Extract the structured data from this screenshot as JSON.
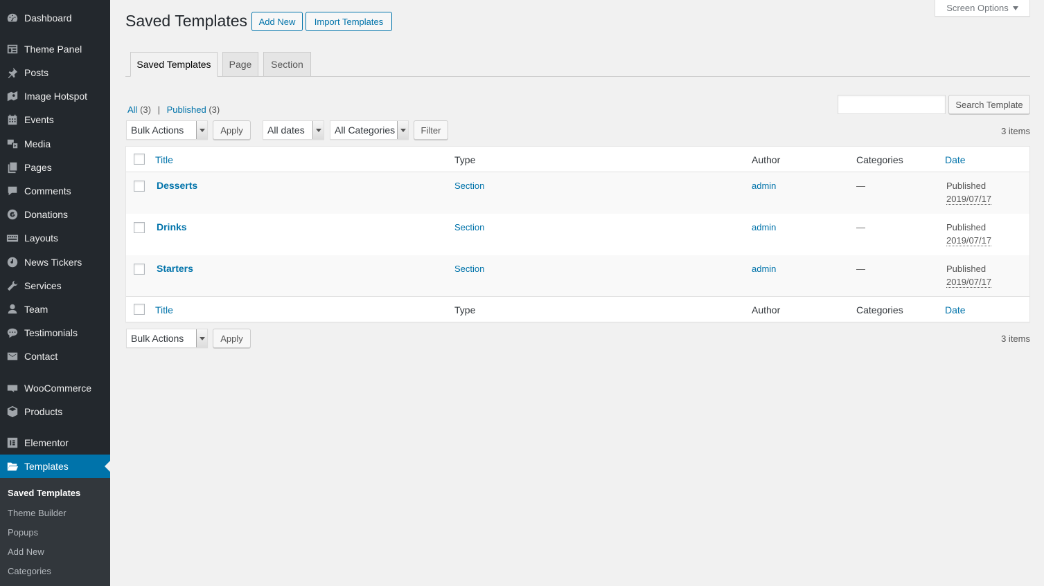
{
  "sidebar": {
    "items": [
      {
        "label": "Dashboard",
        "icon": "dashboard-icon"
      },
      {
        "label": "Theme Panel",
        "icon": "theme-panel-icon"
      },
      {
        "label": "Posts",
        "icon": "pin-icon"
      },
      {
        "label": "Image Hotspot",
        "icon": "image-hotspot-icon"
      },
      {
        "label": "Events",
        "icon": "calendar-icon"
      },
      {
        "label": "Media",
        "icon": "media-icon"
      },
      {
        "label": "Pages",
        "icon": "pages-icon"
      },
      {
        "label": "Comments",
        "icon": "comments-icon"
      },
      {
        "label": "Donations",
        "icon": "donations-icon"
      },
      {
        "label": "Layouts",
        "icon": "layouts-icon"
      },
      {
        "label": "News Tickers",
        "icon": "news-tickers-icon"
      },
      {
        "label": "Services",
        "icon": "wrench-icon"
      },
      {
        "label": "Team",
        "icon": "user-icon"
      },
      {
        "label": "Testimonials",
        "icon": "testimonials-icon"
      },
      {
        "label": "Contact",
        "icon": "mail-icon"
      },
      {
        "label": "WooCommerce",
        "icon": "woocommerce-icon"
      },
      {
        "label": "Products",
        "icon": "products-icon"
      },
      {
        "label": "Elementor",
        "icon": "elementor-icon"
      },
      {
        "label": "Templates",
        "icon": "folder-open-icon"
      }
    ],
    "submenu": [
      "Saved Templates",
      "Theme Builder",
      "Popups",
      "Add New",
      "Categories"
    ]
  },
  "header": {
    "title": "Saved Templates",
    "add_new": "Add New",
    "import": "Import Templates",
    "screen_options": "Screen Options"
  },
  "tabs": [
    "Saved Templates",
    "Page",
    "Section"
  ],
  "views": {
    "all_label": "All",
    "all_count": "(3)",
    "published_label": "Published",
    "published_count": "(3)",
    "separator": "|"
  },
  "search": {
    "button": "Search Template",
    "value": ""
  },
  "filters": {
    "bulk_actions": "Bulk Actions",
    "apply": "Apply",
    "dates": "All dates",
    "categories": "All Categories",
    "filter": "Filter",
    "items_count": "3 items"
  },
  "table": {
    "columns": [
      "Title",
      "Type",
      "Author",
      "Categories",
      "Date"
    ],
    "rows": [
      {
        "title": "Desserts",
        "type": "Section",
        "author": "admin",
        "categories": "—",
        "status": "Published",
        "date": "2019/07/17"
      },
      {
        "title": "Drinks",
        "type": "Section",
        "author": "admin",
        "categories": "—",
        "status": "Published",
        "date": "2019/07/17"
      },
      {
        "title": "Starters",
        "type": "Section",
        "author": "admin",
        "categories": "—",
        "status": "Published",
        "date": "2019/07/17"
      }
    ]
  },
  "colors": {
    "accent": "#0073aa",
    "sidebar_bg": "#23282d",
    "submenu_bg": "#32373c",
    "page_bg": "#f1f1f1"
  }
}
